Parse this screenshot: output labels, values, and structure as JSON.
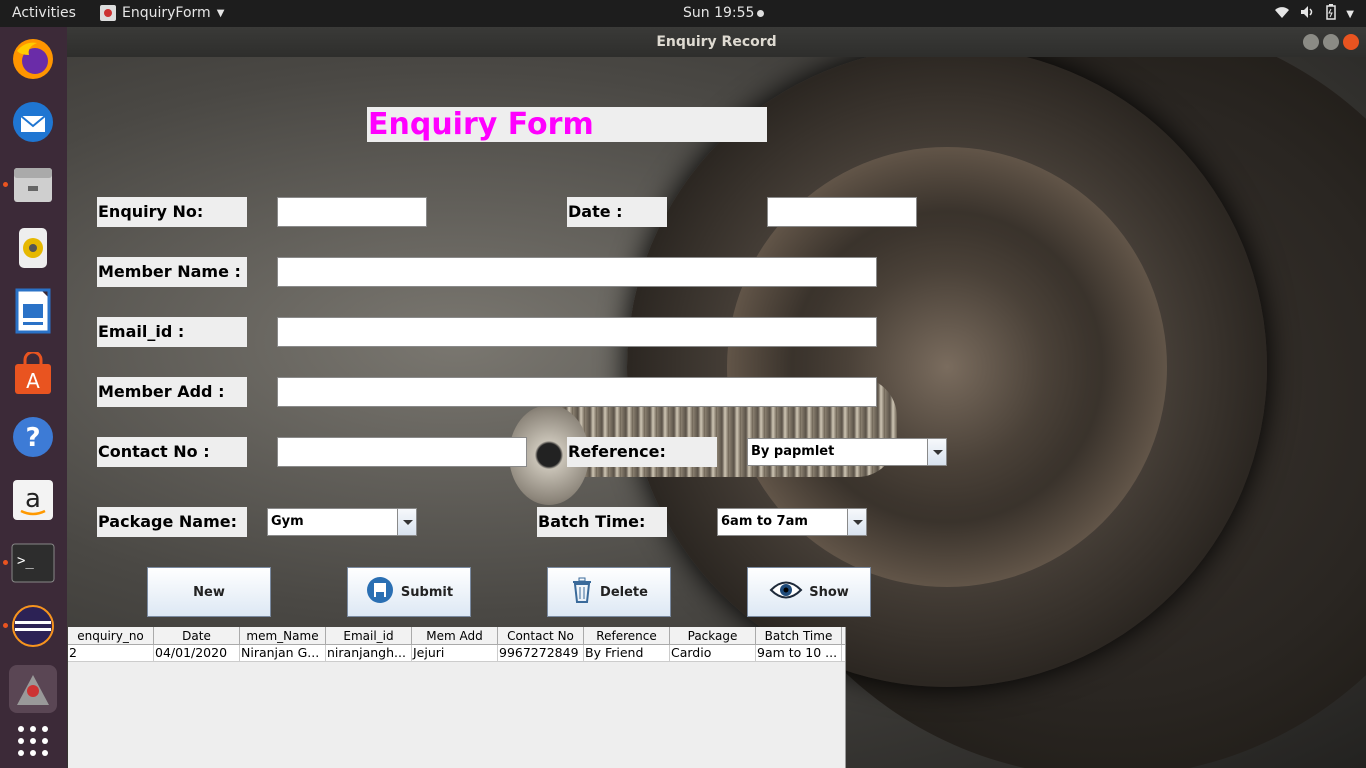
{
  "topbar": {
    "activities": "Activities",
    "app_name": "EnquiryForm",
    "clock": "Sun 19:55"
  },
  "window": {
    "title": "Enquiry  Record"
  },
  "form": {
    "heading": "Enquiry Form",
    "heading_color": "#ff00ff",
    "labels": {
      "enquiry_no": "Enquiry No:",
      "date": "Date :",
      "member_name": "Member Name :",
      "email_id": "Email_id :",
      "member_add": "Member Add :",
      "contact_no": "Contact No :",
      "reference": "Reference:",
      "package_name": "Package Name:",
      "batch_time": "Batch Time:"
    },
    "values": {
      "enquiry_no": "",
      "date": "",
      "member_name": "",
      "email_id": "",
      "member_add": "",
      "contact_no": ""
    },
    "reference_selected": "By papmlet",
    "package_selected": "Gym",
    "batch_selected": "6am to 7am"
  },
  "buttons": {
    "new": "New",
    "submit": "Submit",
    "delete": "Delete",
    "show": "Show"
  },
  "table": {
    "columns": [
      "enquiry_no",
      "Date",
      "mem_Name",
      "Email_id",
      "Mem Add",
      "Contact No",
      "Reference",
      "Package",
      "Batch Time"
    ],
    "rows": [
      [
        "2",
        "04/01/2020",
        "Niranjan G...",
        "niranjangh...",
        "Jejuri",
        "9967272849",
        "By Friend",
        "Cardio",
        "9am to 10 ..."
      ]
    ]
  }
}
